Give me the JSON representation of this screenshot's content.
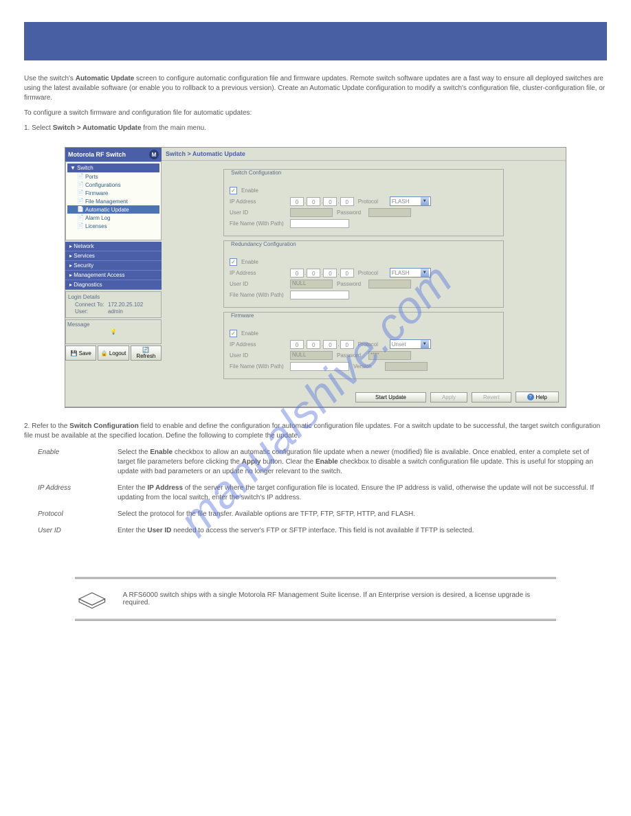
{
  "doc": {
    "intro1": "Use the switch's <b>Automatic Update</b> screen to configure automatic configuration file and firmware updates. Remote switch software updates are a fast way to ensure all deployed switches are using the latest available software (or enable you to rollback to a previous version). Create an Automatic Update configuration to modify a switch's configuration file, cluster-configuration file, or firmware.",
    "intro2": "To configure a switch firmware and configuration file for automatic updates:",
    "step1": "1. Select <b>Switch &gt; Automatic Update</b> from the main menu.",
    "outro1": "2. Refer to the <b>Switch Configuration</b> field to enable and define the configuration for automatic configuration file updates. For a switch update to be successful, the target switch configuration file must be available at the specified location. Define the following to complete the update.",
    "config_fields": [
      {
        "label": "Enable",
        "desc": "Select the <b>Enable</b> checkbox to allow an automatic configuration file update when a newer (modified) file is available. Once enabled, enter a complete set of target file parameters before clicking the <b>Apply</b> button. Clear the <b>Enable</b> checkbox to disable a switch configuration file update. This is useful for stopping an update with bad parameters or an update no longer relevant to the switch."
      },
      {
        "label": "IP Address",
        "desc": "Enter the <b>IP Address</b> of the server where the target configuration file is located. Ensure the IP address is valid, otherwise the update will not be successful. If updating from the local switch, enter the switch's IP address."
      },
      {
        "label": "Protocol",
        "desc": "Select the protocol for the file transfer. Available options are TFTP, FTP, SFTP, HTTP, and FLASH."
      },
      {
        "label": "User ID",
        "desc": "Enter the <b>User ID</b> needed to access the server's FTP or SFTP interface. This field is not available if TFTP is selected."
      }
    ],
    "note_text": "A RFS6000 switch ships with a single Motorola RF Management Suite license. If an Enterprise version is desired, a license upgrade is required."
  },
  "watermark": "manualshive.com",
  "ui": {
    "brand": "Motorola RF Switch",
    "breadcrumb": "Switch > Automatic Update",
    "tree": {
      "header": "▼ Switch",
      "items": [
        "Ports",
        "Configurations",
        "Firmware",
        "File Management",
        "Automatic Update",
        "Alarm Log",
        "Licenses"
      ],
      "active": 4
    },
    "nav": [
      "Network",
      "Services",
      "Security",
      "Management Access",
      "Diagnostics"
    ],
    "login": {
      "title": "Login Details",
      "connect_label": "Connect To:",
      "connect_val": "172.20.25.102",
      "user_label": "User:",
      "user_val": "admin"
    },
    "message_title": "Message",
    "sidebar_buttons": {
      "save": "Save",
      "logout": "Logout",
      "refresh": "Refresh"
    },
    "fieldsets": [
      {
        "legend": "Switch Configuration",
        "enable_label": "Enable",
        "enable_checked": true,
        "ip_label": "IP Address",
        "ip": [
          "0",
          "0",
          "0",
          "0"
        ],
        "protocol_label": "Protocol",
        "protocol_value": "FLASH",
        "userid_label": "User ID",
        "userid_val": "",
        "password_label": "Password",
        "password_val": "",
        "filename_label": "File Name (With Path)",
        "filename_val": ""
      },
      {
        "legend": "Redundancy Configuration",
        "enable_label": "Enable",
        "enable_checked": true,
        "ip_label": "IP Address",
        "ip": [
          "0",
          "0",
          "0",
          "0"
        ],
        "protocol_label": "Protocol",
        "protocol_value": "FLASH",
        "userid_label": "User ID",
        "userid_val": "NULL",
        "password_label": "Password",
        "password_val": "",
        "filename_label": "File Name (With Path)",
        "filename_val": ""
      },
      {
        "legend": "Firmware",
        "enable_label": "Enable",
        "enable_checked": true,
        "ip_label": "IP Address",
        "ip": [
          "0",
          "0",
          "0",
          "0"
        ],
        "protocol_label": "Protocol",
        "protocol_value": "Unset",
        "userid_label": "User ID",
        "userid_val": "NULL",
        "password_label": "Password",
        "password_val": "****",
        "filename_label": "File Name (With Path)",
        "filename_val": "",
        "version_label": "Version",
        "version_val": ""
      }
    ],
    "footer": {
      "start": "Start Update",
      "apply": "Apply",
      "revert": "Revert",
      "help": "Help"
    }
  }
}
